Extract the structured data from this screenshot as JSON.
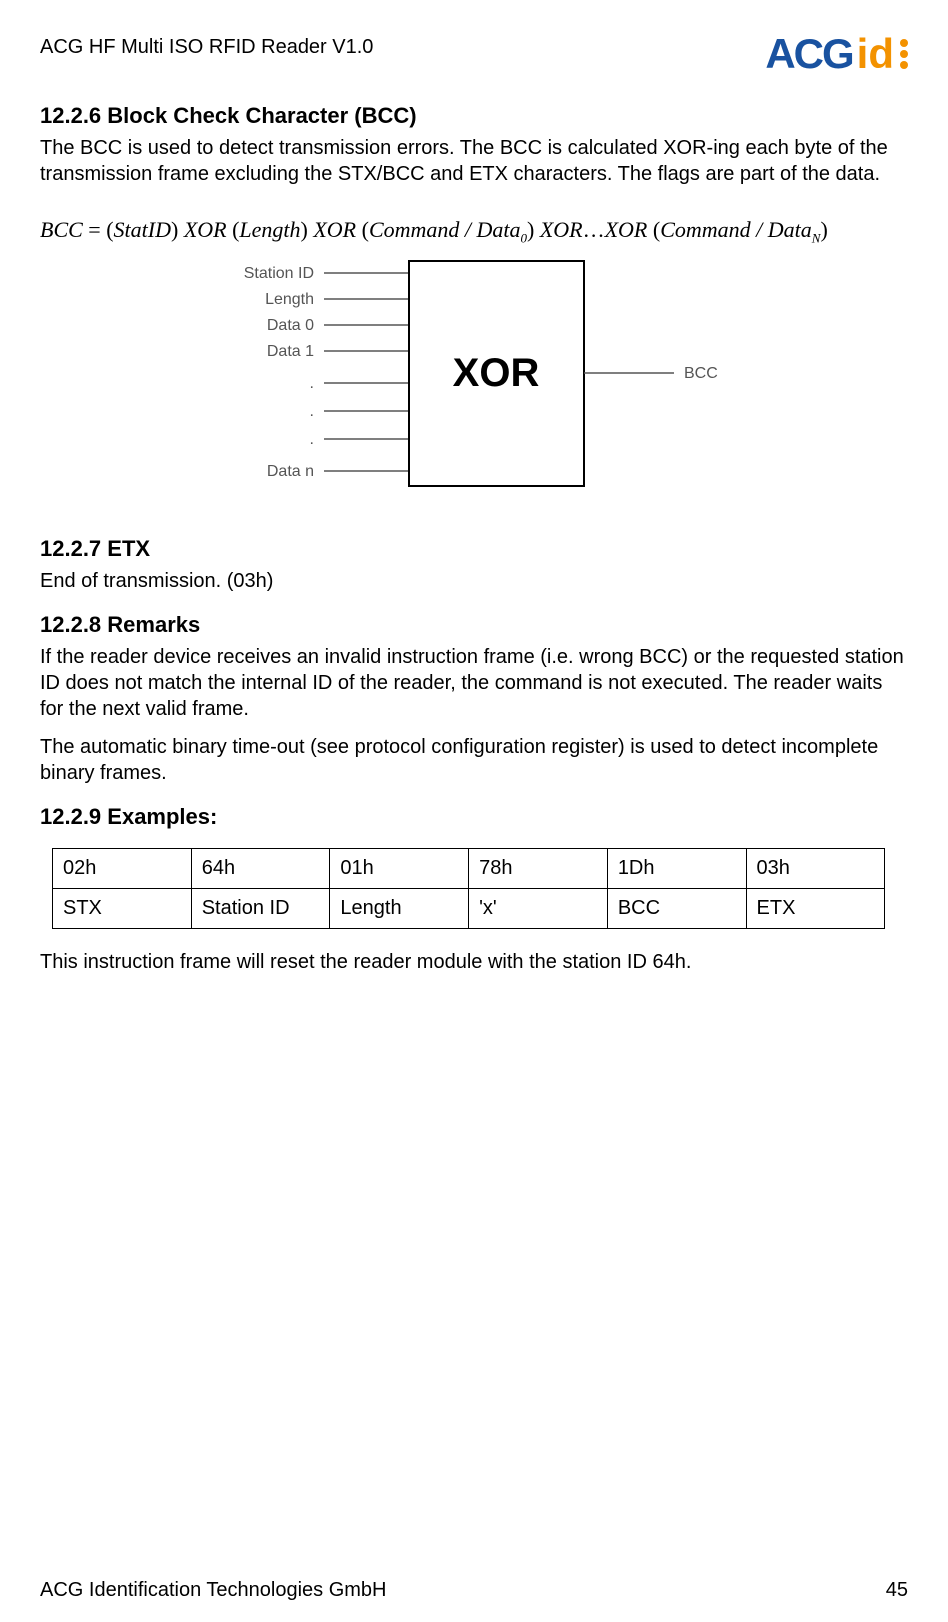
{
  "header": {
    "doc_title": "ACG HF Multi ISO RFID Reader V1.0",
    "logo_acg": "ACG",
    "logo_id": "id"
  },
  "sections": {
    "s1": {
      "heading": "12.2.6 Block Check Character (BCC)",
      "para": "The BCC is used to detect transmission errors. The BCC is calculated XOR-ing each byte of the transmission frame excluding the STX/BCC and ETX characters. The flags are part of the data."
    },
    "formula": {
      "p1": "BCC",
      "eq": " = (",
      "p2": "StatID",
      "p3": ") ",
      "xor": "XOR",
      "lp": " (",
      "p4": "Length",
      "rp": ") ",
      "p5": "Command / Data",
      "sub0": "0",
      "dots": "…",
      "subN": "N",
      "close": ")"
    },
    "diagram": {
      "labels": [
        "Station ID",
        "Length",
        "Data 0",
        "Data 1",
        "Data n"
      ],
      "dots": [
        ".",
        ".",
        "."
      ],
      "xor": "XOR",
      "out": "BCC"
    },
    "s2": {
      "heading": "12.2.7 ETX",
      "para": "End of transmission. (03h)"
    },
    "s3": {
      "heading": "12.2.8 Remarks",
      "para1": "If the reader device receives an invalid instruction frame (i.e. wrong BCC) or the requested station ID does not match the internal ID of the reader, the command is not executed. The reader waits for the next valid frame.",
      "para2": "The automatic binary time-out (see protocol configuration register) is used to detect incomplete binary frames."
    },
    "s4": {
      "heading": "12.2.9 Examples:",
      "table": {
        "row1": [
          "02h",
          "64h",
          "01h",
          "78h",
          "1Dh",
          "03h"
        ],
        "row2": [
          "STX",
          "Station ID",
          "Length",
          "'x'",
          "BCC",
          "ETX"
        ]
      },
      "after": "This instruction frame will reset the reader module with the station ID 64h."
    }
  },
  "footer": {
    "company": "ACG Identification Technologies GmbH",
    "page": "45"
  }
}
